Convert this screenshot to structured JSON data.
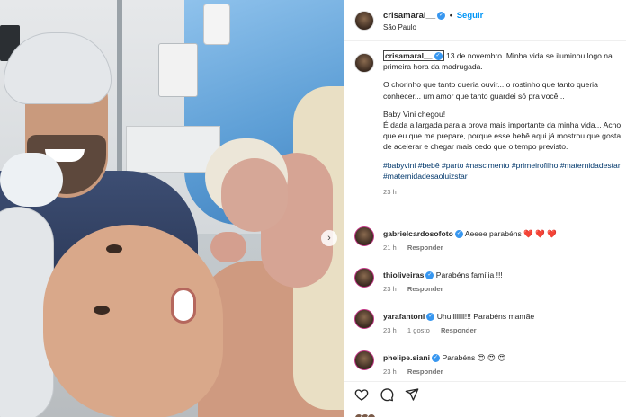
{
  "header": {
    "username": "crisamaral__",
    "follow_label": "Seguir",
    "separator": "•",
    "location": "São Paulo"
  },
  "caption": {
    "username": "crisamaral__",
    "intro": "13 de novembro. Minha vida se iluminou logo na primeira hora da madrugada.",
    "p2": "O chorinho que tanto queria ouvir... o rostinho que tanto queria conhecer... um amor que tanto guardei só pra você...",
    "p3": "Baby Vini chegou!\nÉ dada a largada para a prova mais importante da minha vida... Acho que eu que me prepare, porque esse bebê aqui já mostrou que gosta de acelerar e chegar mais cedo que o tempo previsto.",
    "hashtags": "#babyvini #bebê #parto #nascimento #primeirofilho #maternidadestar #maternidadesaoluizstar",
    "time": "23 h"
  },
  "comments": [
    {
      "username": "gabrielcardosofoto",
      "text": "Aeeee parabéns ❤️ ❤️ ❤️",
      "time": "21 h",
      "likes": "",
      "reply": "Responder"
    },
    {
      "username": "thioliveiras",
      "text": "Parabéns família !!!",
      "time": "23 h",
      "likes": "",
      "reply": "Responder"
    },
    {
      "username": "yarafantoni",
      "text": "Uhullllllll!!! Parabéns mamãe",
      "time": "23 h",
      "likes": "1 gosto",
      "reply": "Responder"
    },
    {
      "username": "phelipe.siani",
      "text": "Parabéns 😍 😍 😍",
      "time": "23 h",
      "likes": "",
      "reply": "Responder"
    }
  ],
  "actions": {
    "like_icon": "heart-icon",
    "comment_icon": "comment-icon",
    "share_icon": "share-icon"
  },
  "photo": {
    "next_icon": "chevron-right-icon"
  },
  "colors": {
    "link": "#00376b",
    "follow": "#0095f6",
    "verified": "#3897f0"
  }
}
